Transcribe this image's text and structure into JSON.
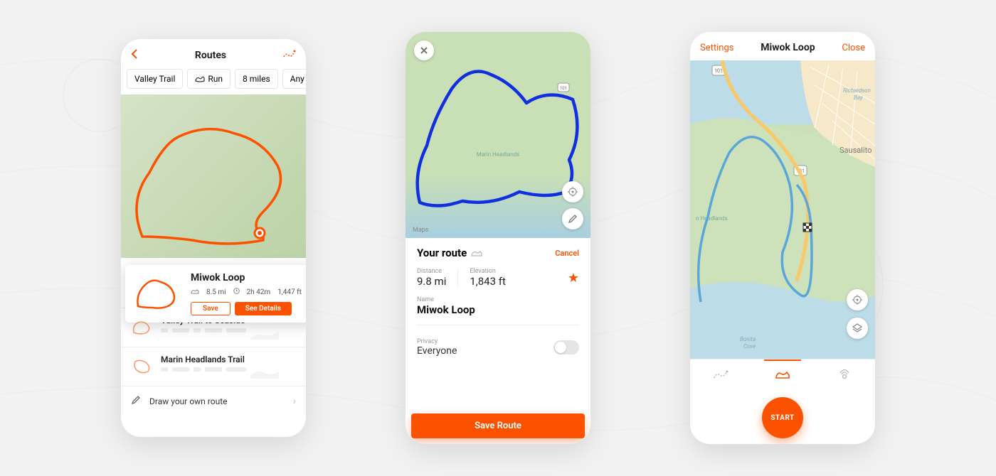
{
  "phone1": {
    "header": {
      "title": "Routes"
    },
    "filters": [
      "Valley Trail",
      "Run",
      "8 miles",
      "Any E"
    ],
    "card": {
      "title": "Miwok Loop",
      "distance": "8.5 mi",
      "duration": "2h 42m",
      "elevation": "1,447 ft",
      "save": "Save",
      "details": "See Details"
    },
    "list": [
      {
        "name": "Valley Trail to Seaside"
      },
      {
        "name": "Marin Headlands Trail"
      }
    ],
    "footer": "Draw your own route"
  },
  "phone2": {
    "panel_title": "Your route",
    "cancel": "Cancel",
    "distance_label": "Distance",
    "distance_value": "9.8 mi",
    "elevation_label": "Elevation",
    "elevation_value": "1,843 ft",
    "name_label": "Name",
    "name_value": "Miwok Loop",
    "privacy_label": "Privacy",
    "privacy_value": "Everyone",
    "save": "Save Route",
    "map_location": "Marin Headlands",
    "maps_attr": "Maps"
  },
  "phone3": {
    "settings": "Settings",
    "title": "Miwok Loop",
    "close": "Close",
    "start": "START",
    "labels": {
      "sausalito": "Sausalito",
      "richardson": "Richardson Bay",
      "headlands": "n Headlands",
      "bonita": "Bonita Cove"
    }
  }
}
